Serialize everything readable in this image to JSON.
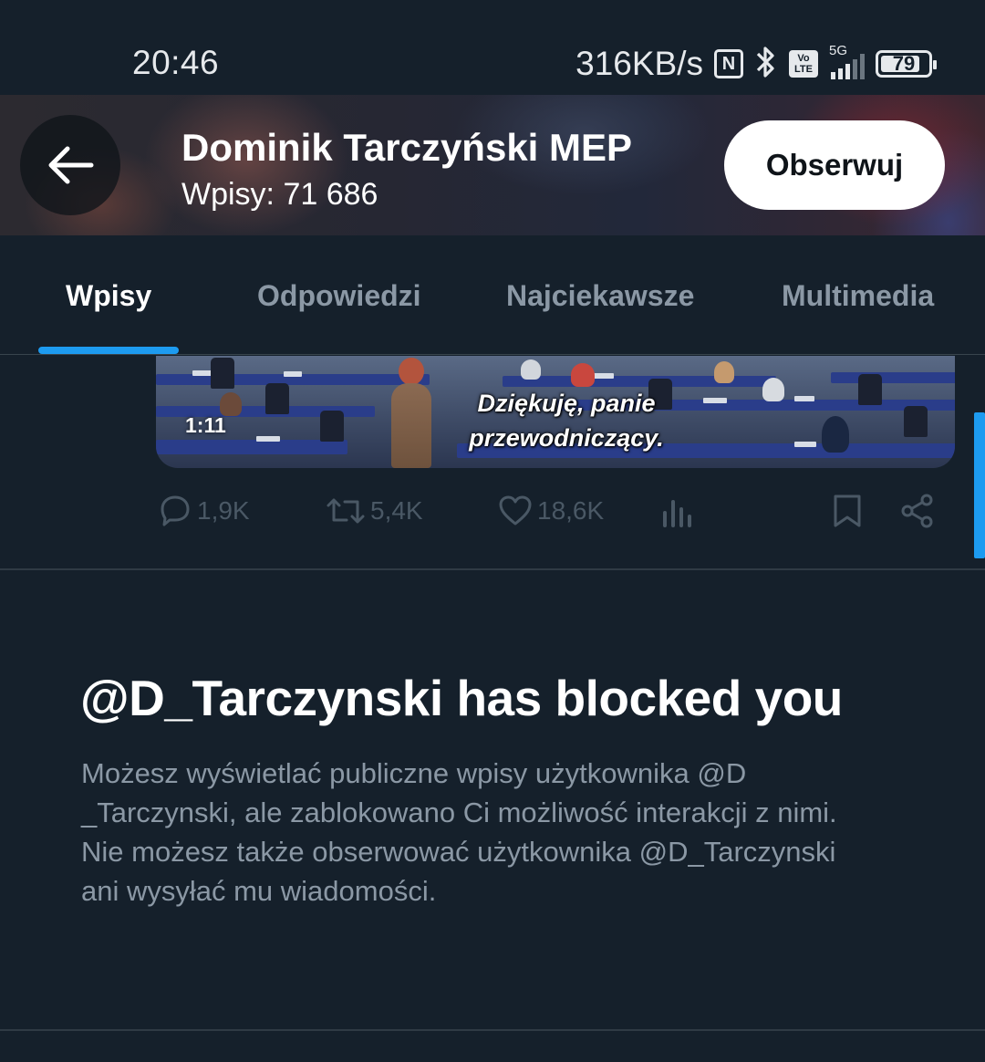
{
  "status_bar": {
    "time": "20:46",
    "net_speed": "316KB/s",
    "nfc_label": "N",
    "volte_line1": "Vo",
    "volte_line2": "LTE",
    "network": "5G",
    "battery": "79"
  },
  "header": {
    "name": "Dominik Tarczyński MEP",
    "post_count": "Wpisy: 71 686",
    "follow_label": "Obserwuj"
  },
  "tabs": [
    {
      "label": "Wpisy",
      "active": true
    },
    {
      "label": "Odpowiedzi",
      "active": false
    },
    {
      "label": "Najciekawsze",
      "active": false
    },
    {
      "label": "Multimedia",
      "active": false
    }
  ],
  "tweet": {
    "video_duration": "1:11",
    "subtitle_line1": "Dziękuję, panie",
    "subtitle_line2": "przewodniczący.",
    "replies": "1,9K",
    "retweets": "5,4K",
    "likes": "18,6K"
  },
  "blocked": {
    "title": "@D_Tarczynski has blocked you",
    "lines": [
      "Możesz wyświetlać publiczne wpisy użytkownika @D",
      "_Tarczynski, ale zablokowano Ci możliwość interakcji z nimi.",
      "Nie możesz także obserwować użytkownika @D_Tarczynski",
      "ani wysyłać mu wiadomości."
    ]
  },
  "colors": {
    "background": "#15202b",
    "accent": "#1d9bf0",
    "secondary_text": "#8b98a5"
  }
}
